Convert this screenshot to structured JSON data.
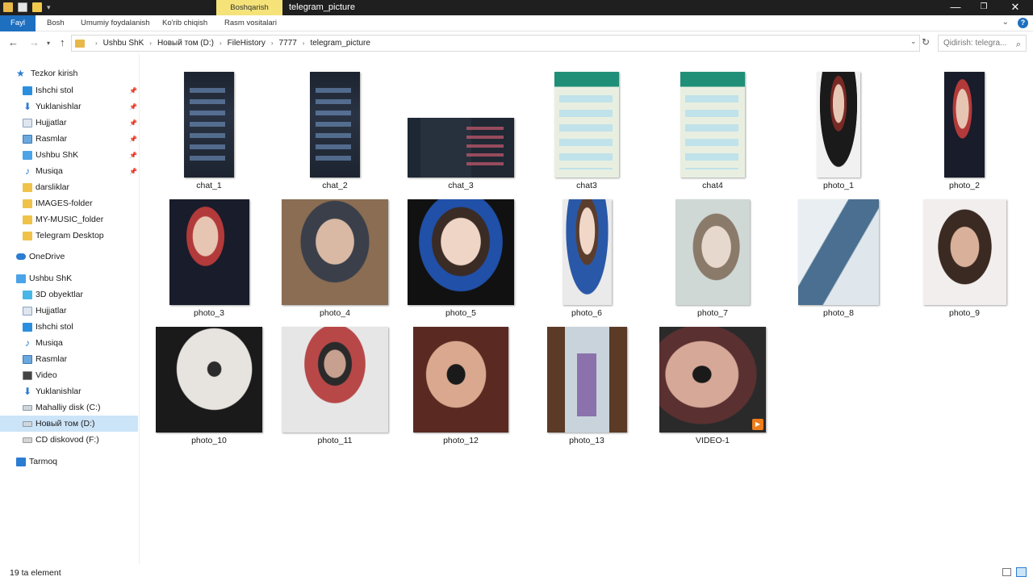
{
  "window": {
    "title": "telegram_picture",
    "contextual_tab": "Boshqarish",
    "controls": {
      "minimize": "—",
      "maximize": "❐",
      "close": "✕"
    }
  },
  "ribbon": {
    "tabs": [
      "Fayl",
      "Bosh",
      "Umumiy foydalanish",
      "Ko'rib chiqish",
      "Rasm vositalari"
    ]
  },
  "address": {
    "breadcrumbs": [
      "Ushbu ShK",
      "Новый том (D:)",
      "FileHistory",
      "7777",
      "telegram_picture"
    ],
    "search_placeholder": "Qidirish: telegra..."
  },
  "nav": {
    "quick_access": "Tezkor kirish",
    "quick_items": [
      {
        "label": "Ishchi stol",
        "icon": "desktop-icon",
        "pinned": true
      },
      {
        "label": "Yuklanishlar",
        "icon": "download-icon",
        "pinned": true
      },
      {
        "label": "Hujjatlar",
        "icon": "documents-icon",
        "pinned": true
      },
      {
        "label": "Rasmlar",
        "icon": "pictures-icon",
        "pinned": true
      },
      {
        "label": "Ushbu ShK",
        "icon": "this-pc-icon",
        "pinned": true
      },
      {
        "label": "Musiqa",
        "icon": "music-icon",
        "pinned": true
      },
      {
        "label": "darsliklar",
        "icon": "folder-icon",
        "pinned": false
      },
      {
        "label": "IMAGES-folder",
        "icon": "folder-icon",
        "pinned": false
      },
      {
        "label": "MY-MUSIC_folder",
        "icon": "folder-icon",
        "pinned": false
      },
      {
        "label": "Telegram Desktop",
        "icon": "folder-icon",
        "pinned": false
      }
    ],
    "onedrive": "OneDrive",
    "this_pc": "Ushbu ShK",
    "pc_items": [
      {
        "label": "3D obyektlar",
        "icon": "3d-objects-icon"
      },
      {
        "label": "Hujjatlar",
        "icon": "documents-icon"
      },
      {
        "label": "Ishchi stol",
        "icon": "desktop-icon"
      },
      {
        "label": "Musiqa",
        "icon": "music-icon"
      },
      {
        "label": "Rasmlar",
        "icon": "pictures-icon"
      },
      {
        "label": "Video",
        "icon": "video-icon"
      },
      {
        "label": "Yuklanishlar",
        "icon": "download-icon"
      },
      {
        "label": "Mahalliy disk (C:)",
        "icon": "disk-icon"
      },
      {
        "label": "Новый том (D:)",
        "icon": "disk-icon",
        "selected": true
      },
      {
        "label": "CD diskovod (F:)",
        "icon": "cd-drive-icon"
      }
    ],
    "network": "Tarmoq"
  },
  "files": [
    {
      "name": "chat_1"
    },
    {
      "name": "chat_2"
    },
    {
      "name": "chat_3"
    },
    {
      "name": "chat3"
    },
    {
      "name": "chat4"
    },
    {
      "name": "photo_1"
    },
    {
      "name": "photo_2"
    },
    {
      "name": "photo_3"
    },
    {
      "name": "photo_4"
    },
    {
      "name": "photo_5"
    },
    {
      "name": "photo_6"
    },
    {
      "name": "photo_7"
    },
    {
      "name": "photo_8"
    },
    {
      "name": "photo_9"
    },
    {
      "name": "photo_10"
    },
    {
      "name": "photo_11"
    },
    {
      "name": "photo_12"
    },
    {
      "name": "photo_13"
    },
    {
      "name": "VIDEO-1"
    }
  ],
  "status": {
    "count": "19 ta element"
  },
  "colors": {
    "accent": "#1e6fbf",
    "selection": "#cce4f7",
    "manage_tab": "#f5e37a",
    "titlebar": "#1f1f1f"
  }
}
